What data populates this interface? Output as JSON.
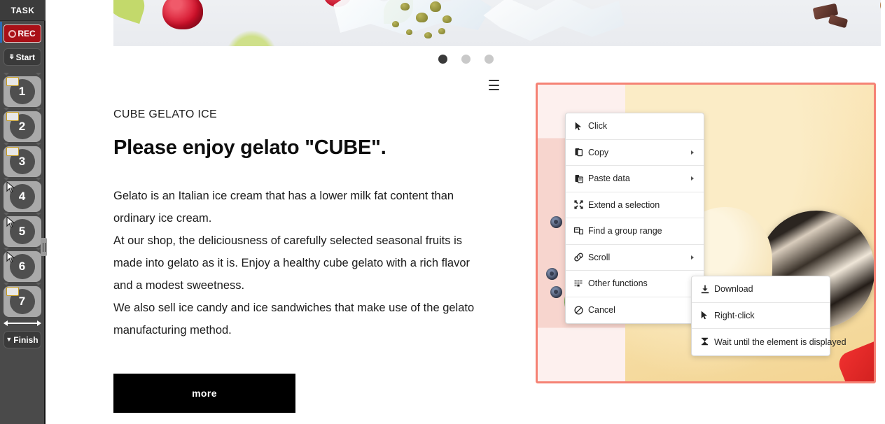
{
  "task_panel": {
    "title": "TASK",
    "rec_label": "REC",
    "start_label": "Start",
    "finish_label": "Finish",
    "steps": [
      {
        "number": "1",
        "icon": "keyboard-icon"
      },
      {
        "number": "2",
        "icon": "keyboard-icon"
      },
      {
        "number": "3",
        "icon": "keyboard-icon"
      },
      {
        "number": "4",
        "icon": "cursor-icon"
      },
      {
        "number": "5",
        "icon": "cursor-icon"
      },
      {
        "number": "6",
        "icon": "cursor-icon"
      },
      {
        "number": "7",
        "icon": "keyboard-icon"
      }
    ]
  },
  "page": {
    "carousel": {
      "dots": [
        "1",
        "2",
        "3"
      ],
      "active_index": 0
    },
    "eyebrow": "CUBE GELATO ICE",
    "headline": "Please enjoy gelato \"CUBE\".",
    "paragraphs": [
      "Gelato is an Italian ice cream that has a lower milk fat content than ordinary ice cream.",
      "At our shop, the deliciousness of carefully selected seasonal fruits is made into gelato as it is. Enjoy a healthy cube gelato with a rich flavor and a modest sweetness.",
      "We also sell ice candy and ice sandwiches that make use of the gelato manufacturing method."
    ],
    "more_label": "more"
  },
  "selection": {
    "border_color": "#f58274",
    "handle_icon": "hamburger-icon"
  },
  "context_menu": {
    "items": [
      {
        "label": "Click",
        "icon": "cursor-icon",
        "submenu": false
      },
      {
        "label": "Copy",
        "icon": "copy-icon",
        "submenu": true
      },
      {
        "label": "Paste data",
        "icon": "paste-icon",
        "submenu": true
      },
      {
        "label": "Extend a selection",
        "icon": "expand-icon",
        "submenu": false
      },
      {
        "label": "Find a group range",
        "icon": "group-range-icon",
        "submenu": false
      },
      {
        "label": "Scroll",
        "icon": "link-icon",
        "submenu": true
      },
      {
        "label": "Other functions",
        "icon": "grid-icon",
        "submenu": false
      },
      {
        "label": "Cancel",
        "icon": "no-entry-icon",
        "submenu": false
      }
    ]
  },
  "submenu": {
    "parent": "Other functions",
    "items": [
      {
        "label": "Download",
        "icon": "download-icon"
      },
      {
        "label": "Right-click",
        "icon": "cursor-icon"
      },
      {
        "label": "Wait until the element is displayed",
        "icon": "hourglass-icon"
      }
    ]
  },
  "colors": {
    "rec_red": "#a91017",
    "panel_bg": "#4a4a4a",
    "selection": "#f58274",
    "button_black": "#000000"
  }
}
